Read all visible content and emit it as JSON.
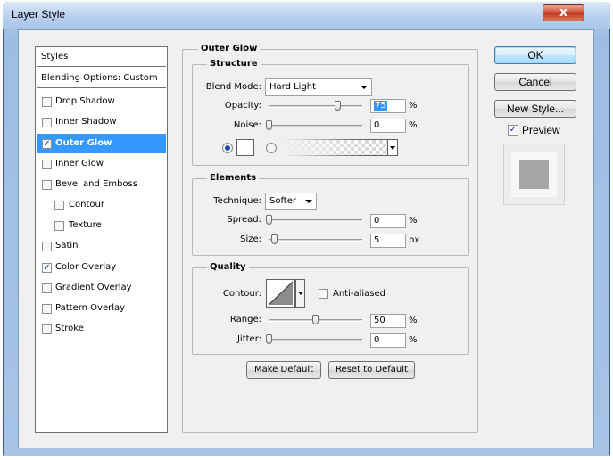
{
  "window": {
    "title": "Layer Style",
    "close_glyph": "x"
  },
  "styles_list": {
    "header": "Styles",
    "blending": "Blending Options: Custom",
    "items": [
      {
        "label": "Drop Shadow",
        "checked": false
      },
      {
        "label": "Inner Shadow",
        "checked": false
      },
      {
        "label": "Outer Glow",
        "checked": true,
        "selected": true
      },
      {
        "label": "Inner Glow",
        "checked": false
      },
      {
        "label": "Bevel and Emboss",
        "checked": false
      },
      {
        "label": "Contour",
        "checked": false,
        "sub": true
      },
      {
        "label": "Texture",
        "checked": false,
        "sub": true
      },
      {
        "label": "Satin",
        "checked": false
      },
      {
        "label": "Color Overlay",
        "checked": true
      },
      {
        "label": "Gradient Overlay",
        "checked": false
      },
      {
        "label": "Pattern Overlay",
        "checked": false
      },
      {
        "label": "Stroke",
        "checked": false
      }
    ]
  },
  "panel": {
    "title": "Outer Glow",
    "structure": {
      "title": "Structure",
      "blend_mode_label": "Blend Mode:",
      "blend_mode_value": "Hard Light",
      "opacity_label": "Opacity:",
      "opacity_value": "75",
      "noise_label": "Noise:",
      "noise_value": "0",
      "unit_percent": "%"
    },
    "elements": {
      "title": "Elements",
      "technique_label": "Technique:",
      "technique_value": "Softer",
      "spread_label": "Spread:",
      "spread_value": "0",
      "size_label": "Size:",
      "size_value": "5",
      "unit_percent": "%",
      "unit_px": "px"
    },
    "quality": {
      "title": "Quality",
      "contour_label": "Contour:",
      "anti_aliased_label": "Anti-aliased",
      "range_label": "Range:",
      "range_value": "50",
      "jitter_label": "Jitter:",
      "jitter_value": "0",
      "unit_percent": "%"
    },
    "make_default": "Make Default",
    "reset_default": "Reset to Default"
  },
  "buttons": {
    "ok": "OK",
    "cancel": "Cancel",
    "new_style": "New Style...",
    "preview_label": "Preview"
  },
  "colors": {
    "selection": "#3399ff",
    "glow_color": "#ffffff",
    "preview_swatch": "#a6a6a6"
  }
}
